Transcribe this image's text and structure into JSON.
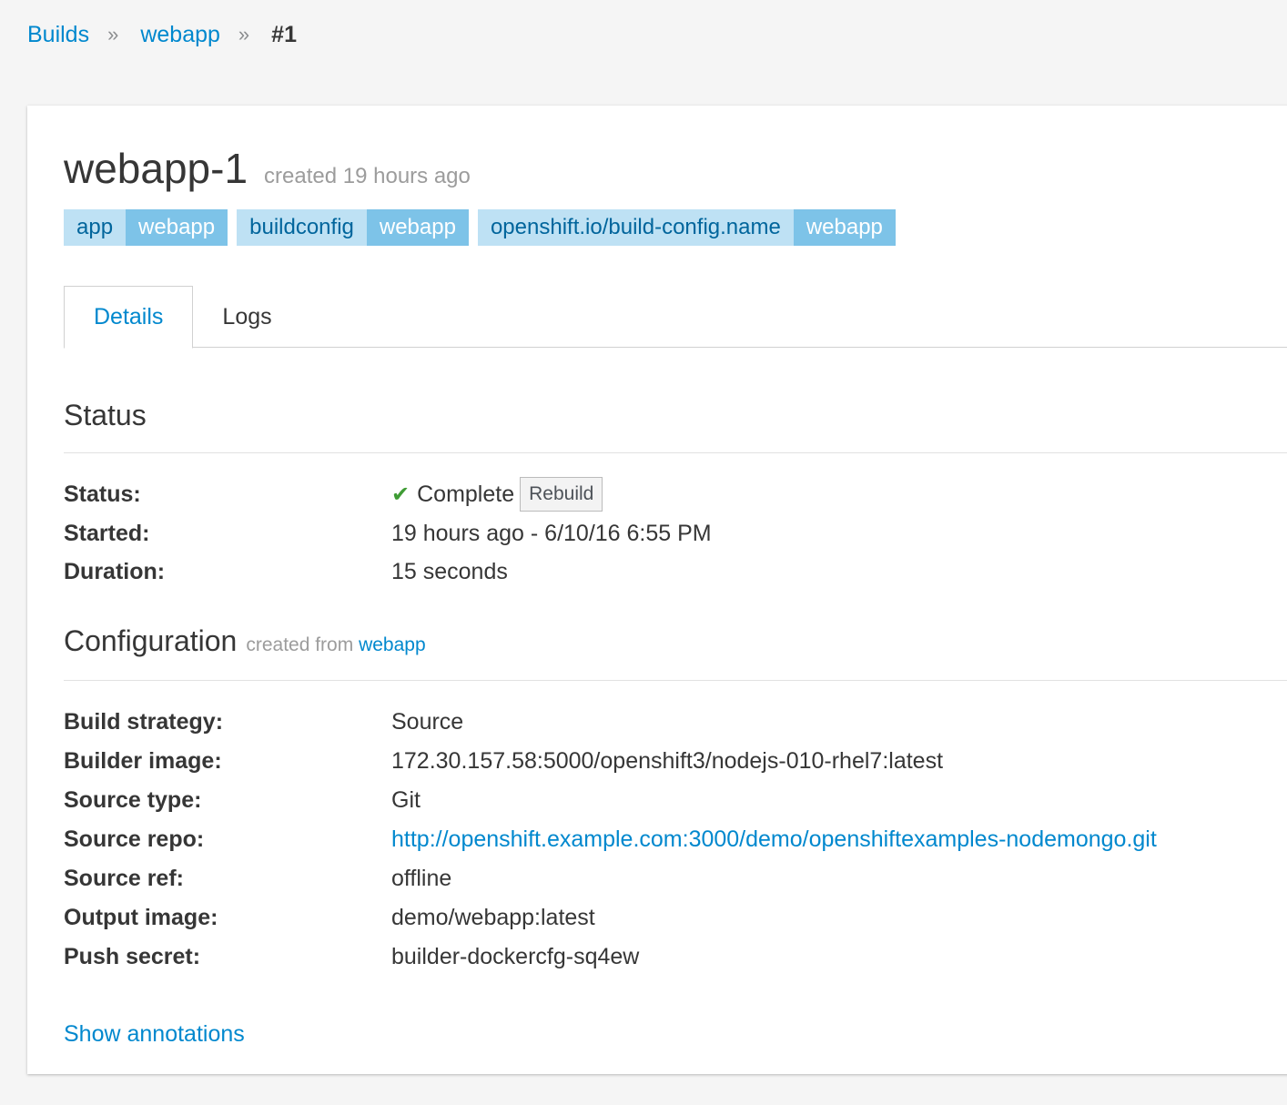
{
  "breadcrumb": {
    "items": [
      "Builds",
      "webapp"
    ],
    "separator": "»",
    "current": "#1"
  },
  "build": {
    "name": "webapp-1",
    "created": "created 19 hours ago"
  },
  "labels": [
    {
      "key": "app",
      "value": "webapp"
    },
    {
      "key": "buildconfig",
      "value": "webapp"
    },
    {
      "key": "openshift.io/build-config.name",
      "value": "webapp"
    }
  ],
  "tabs": [
    {
      "label": "Details",
      "active": true
    },
    {
      "label": "Logs",
      "active": false
    }
  ],
  "status_section": {
    "title": "Status",
    "rows": {
      "status": {
        "key": "Status:",
        "value": "Complete",
        "icon": "check-icon",
        "button": "Rebuild"
      },
      "started": {
        "key": "Started:",
        "value": "19 hours ago - 6/10/16 6:55 PM"
      },
      "duration": {
        "key": "Duration:",
        "value": "15 seconds"
      }
    }
  },
  "config_section": {
    "title": "Configuration",
    "meta_prefix": "created from",
    "meta_link": "webapp",
    "rows": [
      {
        "key": "Build strategy:",
        "value": "Source",
        "link": false
      },
      {
        "key": "Builder image:",
        "value": "172.30.157.58:5000/openshift3/nodejs-010-rhel7:latest",
        "link": false
      },
      {
        "key": "Source type:",
        "value": "Git",
        "link": false
      },
      {
        "key": "Source repo:",
        "value": "http://openshift.example.com:3000/demo/openshiftexamples-nodemongo.git",
        "link": true
      },
      {
        "key": "Source ref:",
        "value": "offline",
        "link": false
      },
      {
        "key": "Output image:",
        "value": "demo/webapp:latest",
        "link": false
      },
      {
        "key": "Push secret:",
        "value": "builder-dockercfg-sq4ew",
        "link": false
      }
    ]
  },
  "show_annotations": "Show annotations",
  "colors": {
    "link": "#0088ce",
    "success": "#3f9c35",
    "label_key_bg": "#bee1f4",
    "label_value_bg": "#7dc3e8"
  }
}
